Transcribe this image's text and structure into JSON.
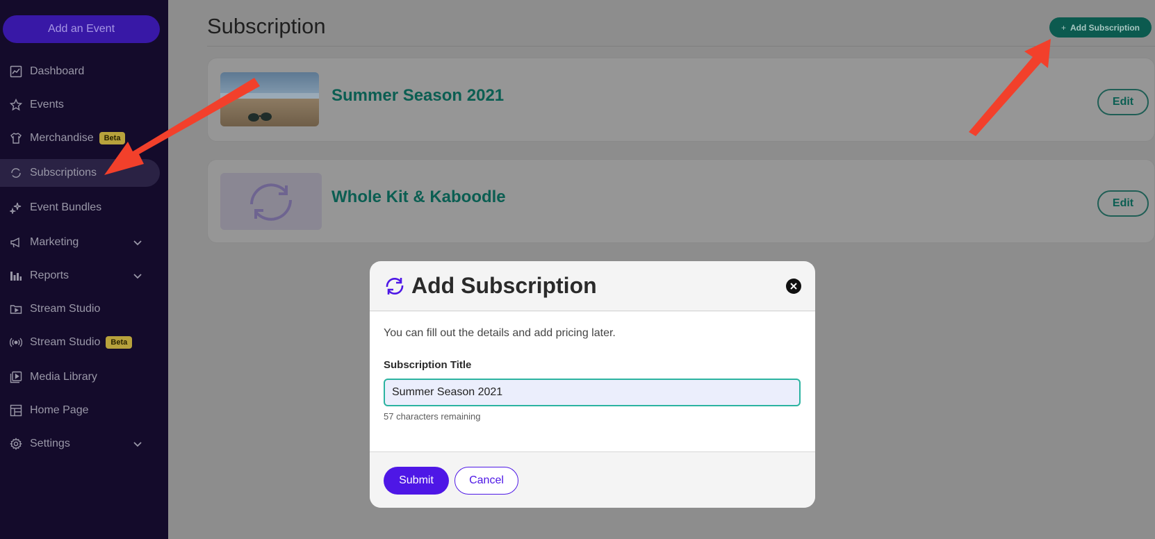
{
  "sidebar": {
    "add_event_label": "Add an Event",
    "items": [
      {
        "label": "Dashboard",
        "icon": "dashboard-icon"
      },
      {
        "label": "Events",
        "icon": "star-icon"
      },
      {
        "label": "Merchandise",
        "icon": "shirt-icon",
        "badge": "Beta"
      },
      {
        "label": "Subscriptions",
        "icon": "refresh-icon",
        "active": true
      },
      {
        "label": "Event Bundles",
        "icon": "sparkles-icon"
      },
      {
        "label": "Marketing",
        "icon": "megaphone-icon",
        "expandable": true
      },
      {
        "label": "Reports",
        "icon": "bar-chart-icon",
        "expandable": true
      },
      {
        "label": "Stream Studio",
        "icon": "film-folder-icon"
      },
      {
        "label": "Stream Studio",
        "icon": "broadcast-icon",
        "badge": "Beta"
      },
      {
        "label": "Media Library",
        "icon": "media-library-icon"
      },
      {
        "label": "Home Page",
        "icon": "layout-icon"
      },
      {
        "label": "Settings",
        "icon": "gear-icon",
        "expandable": true
      }
    ]
  },
  "main": {
    "title": "Subscription",
    "add_button_label": "Add Subscription",
    "cards": [
      {
        "title": "Summer Season 2021",
        "edit_label": "Edit",
        "thumb": "beach-sunglasses-image"
      },
      {
        "title": "Whole Kit & Kaboodle",
        "edit_label": "Edit",
        "thumb": "refresh-placeholder"
      }
    ]
  },
  "modal": {
    "title": "Add Subscription",
    "helper_text": "You can fill out the details and add pricing later.",
    "field_label": "Subscription Title",
    "field_value": "Summer Season 2021",
    "remaining_text": "57 characters remaining",
    "submit_label": "Submit",
    "cancel_label": "Cancel"
  },
  "colors": {
    "sidebar_bg": "#140b2b",
    "accent_purple": "#4e17e6",
    "accent_teal": "#0b5e52",
    "annotation_arrow": "#f2402b"
  }
}
